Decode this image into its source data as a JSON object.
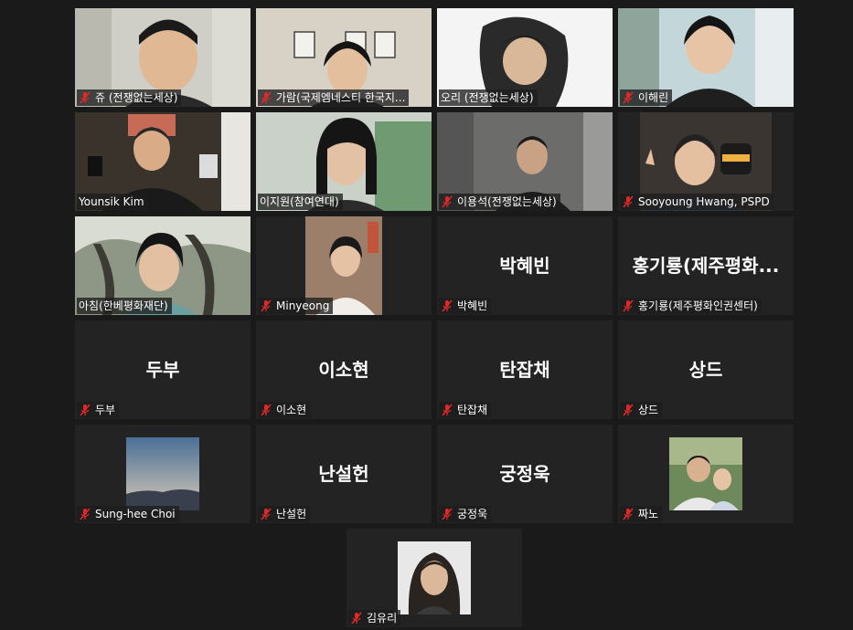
{
  "meeting": {
    "participants": [
      {
        "name": "쥬 (전쟁없는세상)",
        "video": true,
        "muted": true
      },
      {
        "name": "가람(국제엠네스티 한국지...",
        "video": true,
        "muted": true
      },
      {
        "name": "오리 (전쟁없는세상)",
        "video": true,
        "muted": false
      },
      {
        "name": "이해린",
        "video": true,
        "muted": true
      },
      {
        "name": "Younsik Kim",
        "video": true,
        "muted": false
      },
      {
        "name": "이지원(참여연대)",
        "video": true,
        "muted": false,
        "active_speaker": true
      },
      {
        "name": "이용석(전쟁없는세상)",
        "video": true,
        "muted": true
      },
      {
        "name": "Sooyoung Hwang, PSPD",
        "video": true,
        "muted": true
      },
      {
        "name": "아침(한베평화재단)",
        "video": true,
        "muted": false
      },
      {
        "name": "Minyeong",
        "video": true,
        "muted": true
      },
      {
        "name": "박혜빈",
        "display_name": "박혜빈",
        "video": false,
        "muted": true
      },
      {
        "name": "홍기룡(제주평화인권센터)",
        "display_name": "홍기룡(제주평화...",
        "video": false,
        "muted": true
      },
      {
        "name": "두부",
        "display_name": "두부",
        "video": false,
        "muted": true
      },
      {
        "name": "이소현",
        "display_name": "이소현",
        "video": false,
        "muted": true
      },
      {
        "name": "탄잡채",
        "display_name": "탄잡채",
        "video": false,
        "muted": true
      },
      {
        "name": "상드",
        "display_name": "상드",
        "video": false,
        "muted": true
      },
      {
        "name": "Sung-hee Choi",
        "video": false,
        "photo": true,
        "muted": true
      },
      {
        "name": "난설헌",
        "display_name": "난설헌",
        "video": false,
        "muted": true
      },
      {
        "name": "궁정욱",
        "display_name": "궁정욱",
        "video": false,
        "muted": true
      },
      {
        "name": "짜노",
        "video": false,
        "photo": true,
        "muted": true
      },
      {
        "name": "김유리",
        "video": false,
        "photo": true,
        "muted": true
      }
    ]
  },
  "colors": {
    "background": "#1a1a1a",
    "tile": "#232323",
    "active_border": "#d9e68f",
    "muted_icon": "#e02828"
  }
}
